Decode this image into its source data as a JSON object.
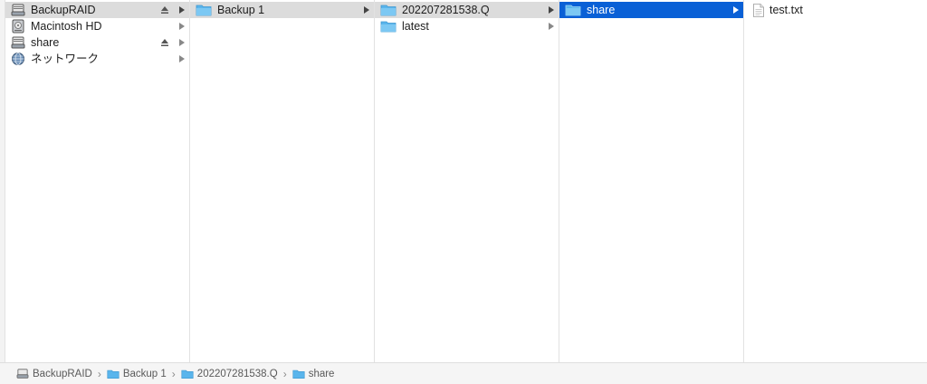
{
  "sidebar": {
    "items": [
      {
        "label": "BackupRAID",
        "icon": "drive-icon",
        "eject": true
      },
      {
        "label": "Macintosh HD",
        "icon": "hard-disk-icon",
        "eject": false
      },
      {
        "label": "share",
        "icon": "drive-icon",
        "eject": true
      },
      {
        "label": "ネットワーク",
        "icon": "network-globe-icon",
        "eject": false
      }
    ]
  },
  "column2": {
    "items": [
      {
        "label": "Backup 1",
        "icon": "folder-icon"
      }
    ]
  },
  "column3": {
    "items": [
      {
        "label": "202207281538.Q",
        "icon": "folder-icon"
      },
      {
        "label": "latest",
        "icon": "folder-icon"
      }
    ]
  },
  "column4": {
    "items": [
      {
        "label": "share",
        "icon": "folder-icon"
      }
    ]
  },
  "column5": {
    "items": [
      {
        "label": "test.txt",
        "icon": "text-file-icon"
      }
    ]
  },
  "pathbar": {
    "crumbs": [
      {
        "label": "BackupRAID",
        "icon": "drive-icon"
      },
      {
        "label": "Backup 1",
        "icon": "folder-icon"
      },
      {
        "label": "202207281538.Q",
        "icon": "folder-icon"
      },
      {
        "label": "share",
        "icon": "folder-icon"
      }
    ],
    "separator": "›"
  },
  "colors": {
    "selection_blue": "#0a60d6",
    "selection_gray": "#dcdcdc",
    "folder_blue": "#5ab5ec"
  }
}
